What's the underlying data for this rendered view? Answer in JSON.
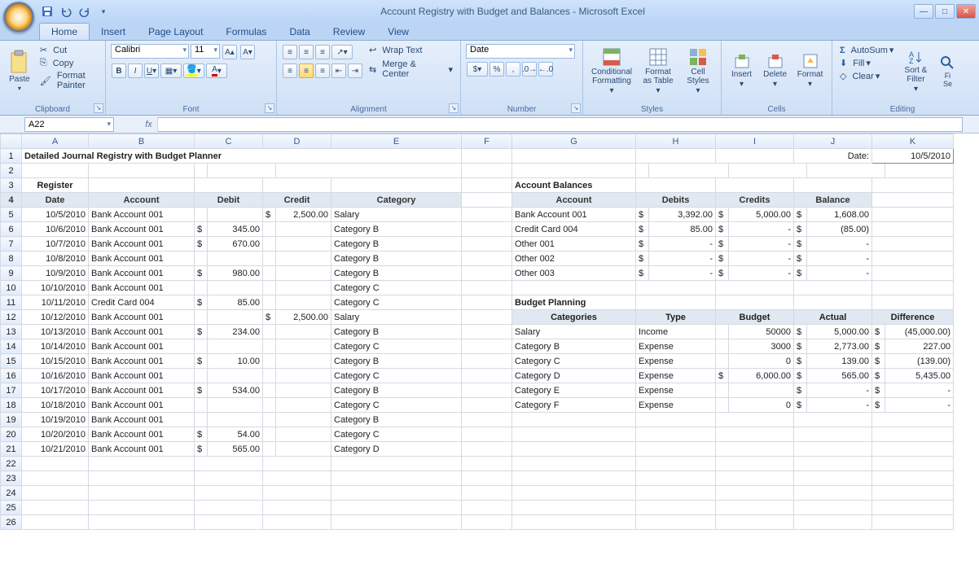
{
  "app": {
    "title": "Account Registry with Budget and Balances - Microsoft Excel",
    "namebox": "A22",
    "tabs": [
      "Home",
      "Insert",
      "Page Layout",
      "Formulas",
      "Data",
      "Review",
      "View"
    ],
    "activeTab": "Home"
  },
  "ribbon": {
    "clipboard": {
      "label": "Clipboard",
      "paste": "Paste",
      "cut": "Cut",
      "copy": "Copy",
      "fp": "Format Painter"
    },
    "font": {
      "label": "Font",
      "name": "Calibri",
      "size": "11"
    },
    "alignment": {
      "label": "Alignment",
      "wrap": "Wrap Text",
      "merge": "Merge & Center"
    },
    "number": {
      "label": "Number",
      "format": "Date"
    },
    "styles": {
      "label": "Styles",
      "cf": "Conditional Formatting",
      "fat": "Format as Table",
      "cs": "Cell Styles"
    },
    "cells": {
      "label": "Cells",
      "insert": "Insert",
      "delete": "Delete",
      "format": "Format"
    },
    "editing": {
      "label": "Editing",
      "sum": "AutoSum",
      "fill": "Fill",
      "clear": "Clear",
      "sort": "Sort & Filter",
      "find": "Find & Select"
    }
  },
  "sheet": {
    "columns": [
      "A",
      "B",
      "C",
      "D",
      "E",
      "F",
      "G",
      "H",
      "I",
      "J",
      "K"
    ],
    "title": "Detailed Journal Registry with Budget Planner",
    "dateLabel": "Date:",
    "dateValue": "10/5/2010",
    "registerLabel": "Register",
    "registerHeaders": {
      "date": "Date",
      "account": "Account",
      "debit": "Debit",
      "credit": "Credit",
      "category": "Category"
    },
    "register": [
      {
        "date": "10/5/2010",
        "acct": "Bank Account 001",
        "debit": "",
        "credit": "2,500.00",
        "cat": "Salary"
      },
      {
        "date": "10/6/2010",
        "acct": "Bank Account 001",
        "debit": "345.00",
        "credit": "",
        "cat": "Category B"
      },
      {
        "date": "10/7/2010",
        "acct": "Bank Account 001",
        "debit": "670.00",
        "credit": "",
        "cat": "Category B"
      },
      {
        "date": "10/8/2010",
        "acct": "Bank Account 001",
        "debit": "",
        "credit": "",
        "cat": "Category B"
      },
      {
        "date": "10/9/2010",
        "acct": "Bank Account 001",
        "debit": "980.00",
        "credit": "",
        "cat": "Category B"
      },
      {
        "date": "10/10/2010",
        "acct": "Bank Account 001",
        "debit": "",
        "credit": "",
        "cat": "Category C"
      },
      {
        "date": "10/11/2010",
        "acct": "Credit Card 004",
        "debit": "85.00",
        "credit": "",
        "cat": "Category C"
      },
      {
        "date": "10/12/2010",
        "acct": "Bank Account 001",
        "debit": "",
        "credit": "2,500.00",
        "cat": "Salary"
      },
      {
        "date": "10/13/2010",
        "acct": "Bank Account 001",
        "debit": "234.00",
        "credit": "",
        "cat": "Category B"
      },
      {
        "date": "10/14/2010",
        "acct": "Bank Account 001",
        "debit": "",
        "credit": "",
        "cat": "Category C"
      },
      {
        "date": "10/15/2010",
        "acct": "Bank Account 001",
        "debit": "10.00",
        "credit": "",
        "cat": "Category B"
      },
      {
        "date": "10/16/2010",
        "acct": "Bank Account 001",
        "debit": "",
        "credit": "",
        "cat": "Category C"
      },
      {
        "date": "10/17/2010",
        "acct": "Bank Account 001",
        "debit": "534.00",
        "credit": "",
        "cat": "Category B"
      },
      {
        "date": "10/18/2010",
        "acct": "Bank Account 001",
        "debit": "",
        "credit": "",
        "cat": "Category C"
      },
      {
        "date": "10/19/2010",
        "acct": "Bank Account 001",
        "debit": "",
        "credit": "",
        "cat": "Category B"
      },
      {
        "date": "10/20/2010",
        "acct": "Bank Account 001",
        "debit": "54.00",
        "credit": "",
        "cat": "Category C"
      },
      {
        "date": "10/21/2010",
        "acct": "Bank Account 001",
        "debit": "565.00",
        "credit": "",
        "cat": "Category D"
      }
    ],
    "balancesLabel": "Account Balances",
    "balHeaders": {
      "account": "Account",
      "debits": "Debits",
      "credits": "Credits",
      "balance": "Balance"
    },
    "balances": [
      {
        "acct": "Bank Account 001",
        "deb": "3,392.00",
        "cred": "5,000.00",
        "bal": "1,608.00"
      },
      {
        "acct": "Credit Card 004",
        "deb": "85.00",
        "cred": "-",
        "bal": "(85.00)"
      },
      {
        "acct": "Other 001",
        "deb": "-",
        "cred": "-",
        "bal": "-"
      },
      {
        "acct": "Other 002",
        "deb": "-",
        "cred": "-",
        "bal": "-"
      },
      {
        "acct": "Other 003",
        "deb": "-",
        "cred": "-",
        "bal": "-"
      }
    ],
    "budgetLabel": "Budget Planning",
    "budHeaders": {
      "cat": "Categories",
      "type": "Type",
      "budget": "Budget",
      "actual": "Actual",
      "diff": "Difference"
    },
    "budget": [
      {
        "cat": "Salary",
        "type": "Income",
        "bcurr": "",
        "budget": "50000",
        "actual": "5,000.00",
        "diff": "(45,000.00)"
      },
      {
        "cat": "Category B",
        "type": "Expense",
        "bcurr": "",
        "budget": "3000",
        "actual": "2,773.00",
        "diff": "227.00"
      },
      {
        "cat": "Category C",
        "type": "Expense",
        "bcurr": "",
        "budget": "0",
        "actual": "139.00",
        "diff": "(139.00)"
      },
      {
        "cat": "Category D",
        "type": "Expense",
        "bcurr": "$",
        "budget": "6,000.00",
        "actual": "565.00",
        "diff": "5,435.00"
      },
      {
        "cat": "Category E",
        "type": "Expense",
        "bcurr": "",
        "budget": "",
        "actual": "-",
        "diff": "-"
      },
      {
        "cat": "Category F",
        "type": "Expense",
        "bcurr": "",
        "budget": "0",
        "actual": "-",
        "diff": "-"
      }
    ]
  }
}
